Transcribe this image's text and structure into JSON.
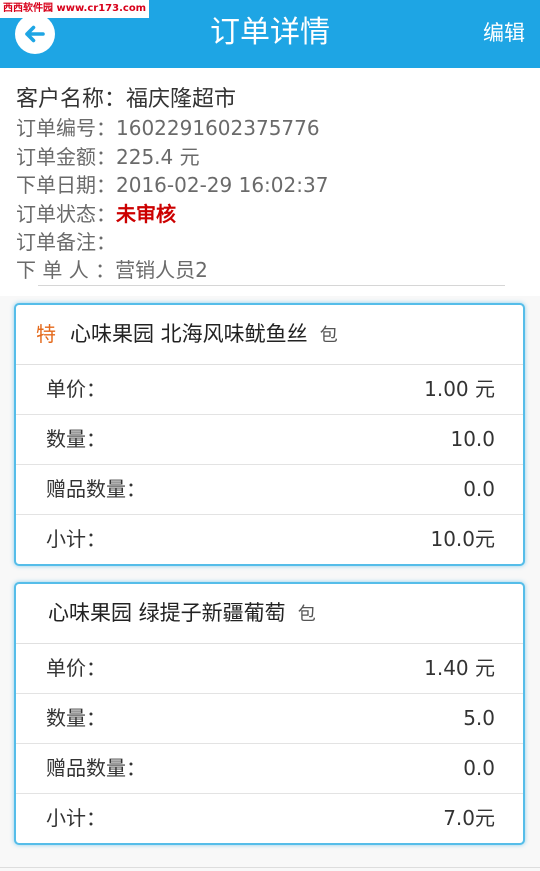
{
  "watermark": "西西软件园 www.cr173.com",
  "header": {
    "title": "订单详情",
    "edit_label": "编辑",
    "back_icon": "back-arrow-circle-icon"
  },
  "order": {
    "customer": {
      "label": "客户名称：",
      "value": "福庆隆超市"
    },
    "number": {
      "label": "订单编号：",
      "value": "1602291602375776"
    },
    "amount": {
      "label": "订单金额：",
      "value": "225.4 元"
    },
    "date": {
      "label": "下单日期：",
      "value": "2016-02-29 16:02:37"
    },
    "status": {
      "label": "订单状态：",
      "value": "未审核"
    },
    "note": {
      "label": "订单备注：",
      "value": ""
    },
    "creator": {
      "label": "下 单 人 ：",
      "value": "营销人员2"
    }
  },
  "items": [
    {
      "badge": "特",
      "name": "心味果园 北海风味鱿鱼丝",
      "unit": "包",
      "rows": [
        {
          "label": "单价：",
          "value": "1.00 元"
        },
        {
          "label": "数量：",
          "value": "10.0"
        },
        {
          "label": "赠品数量：",
          "value": "0.0"
        },
        {
          "label": "小计：",
          "value": "10.0元"
        }
      ]
    },
    {
      "name": "心味果园 绿提子新疆葡萄",
      "unit": "包",
      "rows": [
        {
          "label": "单价：",
          "value": "1.40 元"
        },
        {
          "label": "数量：",
          "value": "5.0"
        },
        {
          "label": "赠品数量：",
          "value": "0.0"
        },
        {
          "label": "小计：",
          "value": "7.0元"
        }
      ]
    }
  ],
  "colors": {
    "header_bg": "#1ea5e4",
    "status_red": "#cc0000",
    "badge_orange": "#e46a1c",
    "card_border": "#55bde9"
  }
}
